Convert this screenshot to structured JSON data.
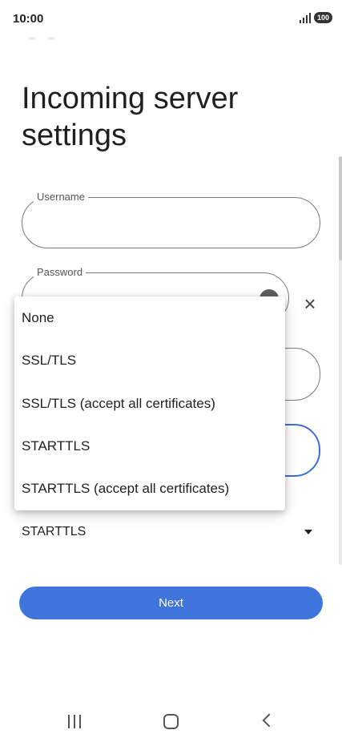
{
  "status_bar": {
    "time": "10:00",
    "battery": "100"
  },
  "page": {
    "title": "Incoming server settings"
  },
  "form": {
    "username": {
      "label": "Username",
      "value": ""
    },
    "password": {
      "label": "Password",
      "value": ""
    },
    "security": {
      "selected": "STARTTLS"
    }
  },
  "dropdown": {
    "options": [
      "None",
      "SSL/TLS",
      "SSL/TLS (accept all certificates)",
      "STARTTLS",
      "STARTTLS (accept all certificates)"
    ]
  },
  "actions": {
    "next_label": "Next"
  },
  "icons": {
    "clear": "close-icon",
    "visibility": "visibility-icon",
    "nav": [
      "recent-apps-icon",
      "home-icon",
      "back-icon"
    ]
  },
  "colors": {
    "accent": "#3f74dd",
    "focus_outline": "#3b6fd8"
  }
}
